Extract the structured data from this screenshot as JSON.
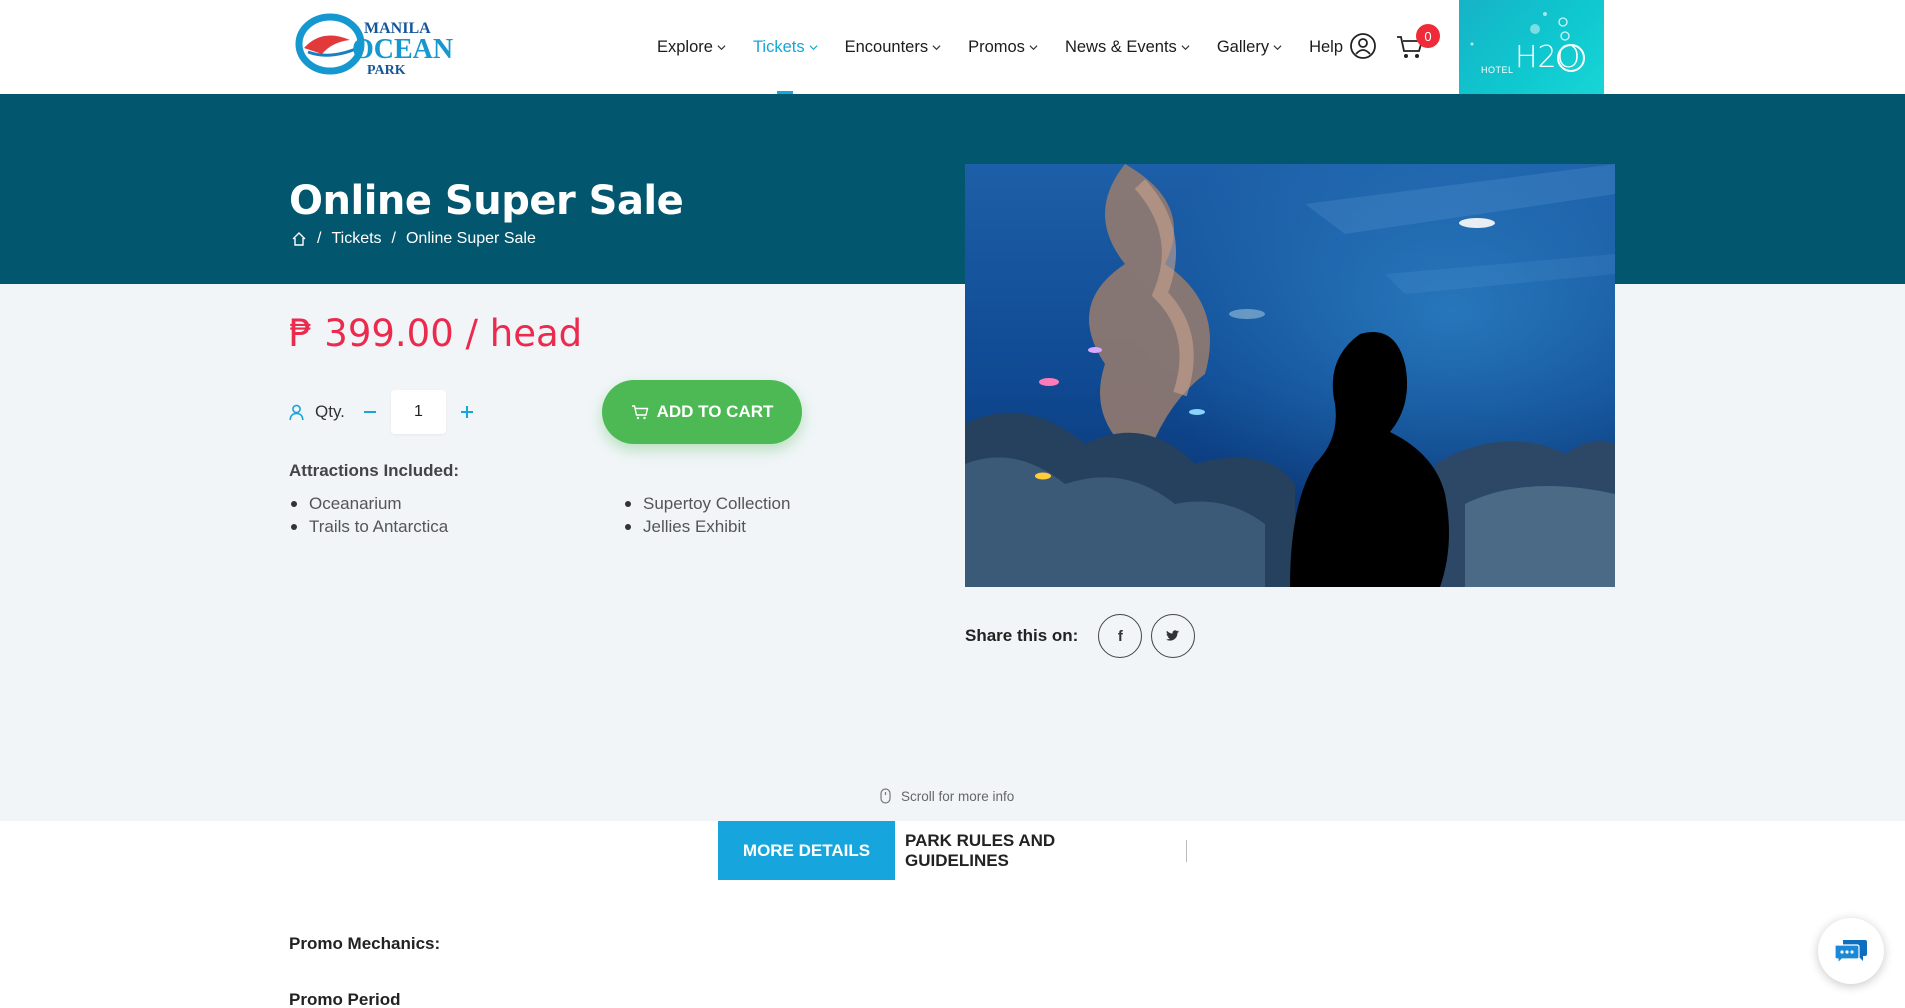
{
  "brand": {
    "logo_line1": "MANILA",
    "logo_line2": "OCEAN",
    "logo_line3": "PARK"
  },
  "nav": {
    "items": [
      {
        "label": "Explore",
        "has_dropdown": true
      },
      {
        "label": "Tickets",
        "has_dropdown": true,
        "active": true
      },
      {
        "label": "Encounters",
        "has_dropdown": true
      },
      {
        "label": "Promos",
        "has_dropdown": true
      },
      {
        "label": "News & Events",
        "has_dropdown": true
      },
      {
        "label": "Gallery",
        "has_dropdown": true
      },
      {
        "label": "Help",
        "has_dropdown": false
      }
    ],
    "cart_count": "0",
    "hotel_label": "HOTEL",
    "hotel_name": "H2O"
  },
  "banner": {
    "title": "Online Super Sale",
    "breadcrumb": [
      "Tickets",
      "Online Super Sale"
    ]
  },
  "product": {
    "price": "₱ 399.00 / head",
    "qty_label": "Qty.",
    "qty_value": "1",
    "add_to_cart_label": "ADD TO CART",
    "attractions_title": "Attractions Included:",
    "attractions_col1": [
      "Oceanarium",
      "Trails to Antarctica"
    ],
    "attractions_col2": [
      "Supertoy Collection",
      "Jellies Exhibit"
    ]
  },
  "share": {
    "label": "Share this on:",
    "facebook": "f"
  },
  "scroll_hint": "Scroll for more info",
  "tabs": {
    "more_details": "MORE DETAILS",
    "park_rules": "PARK RULES AND GUIDELINES"
  },
  "details": {
    "promo_mechanics": "Promo Mechanics:",
    "promo_period": "Promo Period"
  },
  "colors": {
    "accent": "#16a6d7",
    "banner": "#02566e",
    "price": "#ec2a4e",
    "cta": "#4cb954"
  }
}
